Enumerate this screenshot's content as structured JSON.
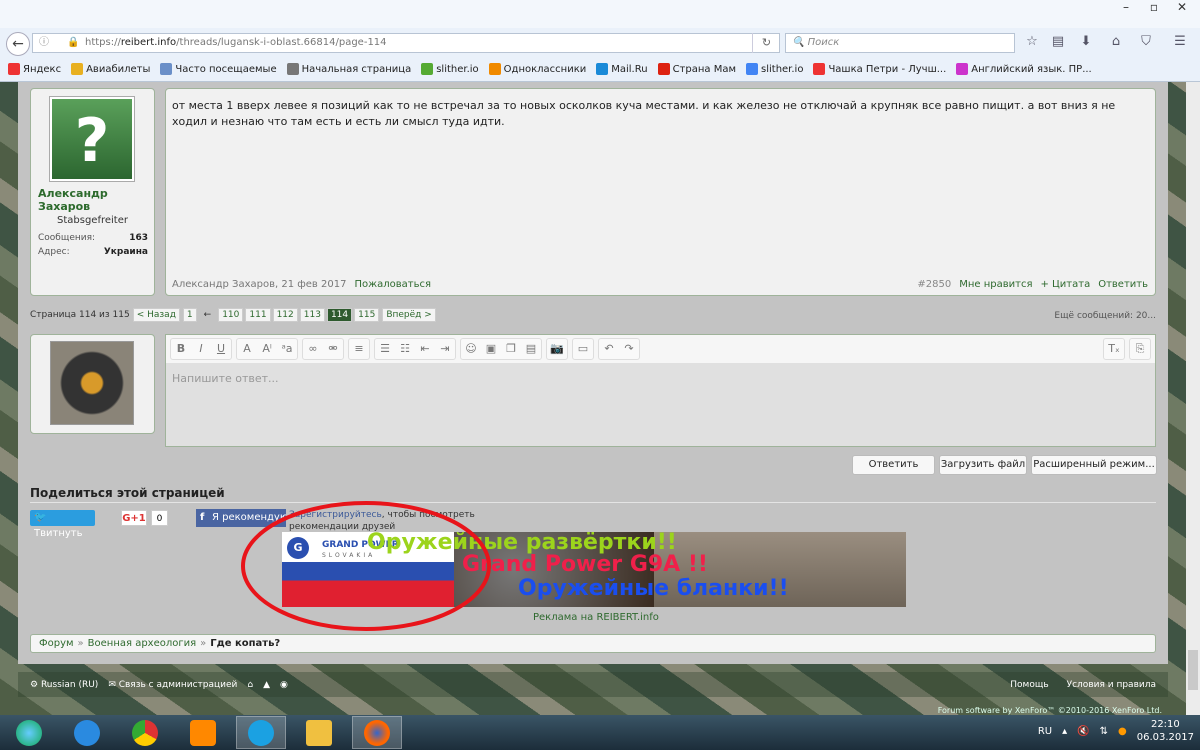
{
  "browser": {
    "url_domain": "reibert.info",
    "url_prefix": "https://",
    "url_path": "/threads/lugansk-i-oblast.66814/page-114",
    "search_placeholder": "Поиск",
    "bookmarks": [
      {
        "label": "Яндекс",
        "color": "#e33"
      },
      {
        "label": "Авиабилеты",
        "color": "#e8b020"
      },
      {
        "label": "Часто посещаемые",
        "color": "#6a8fc8"
      },
      {
        "label": "Начальная страница",
        "color": "#777"
      },
      {
        "label": "slither.io",
        "color": "#5a3"
      },
      {
        "label": "Одноклассники",
        "color": "#f08a00"
      },
      {
        "label": "Mail.Ru",
        "color": "#1a8ad8"
      },
      {
        "label": "Страна Мам",
        "color": "#d21"
      },
      {
        "label": "slither.io",
        "color": "#4285f4"
      },
      {
        "label": "Чашка Петри - Лучш...",
        "color": "#e33"
      },
      {
        "label": "Английский язык. ПР...",
        "color": "#c3c"
      }
    ]
  },
  "post": {
    "author": "Александр Захаров",
    "user_title": "Stabsgefreiter",
    "stats": [
      {
        "label": "Сообщения:",
        "value": "163"
      },
      {
        "label": "Адрес:",
        "value": "Украина"
      }
    ],
    "text": "от места 1 вверх левее я позиций как то не встречал за то новых осколков куча местами. и как железо не отключай а крупняк все равно пищит. а вот вниз я не ходил и незнаю что там есть и есть ли смысл туда идти.",
    "meta": "Александр Захаров, 21 фев 2017",
    "report": "Пожаловаться",
    "number": "#2850",
    "like": "Мне нравится",
    "quote": "+ Цитата",
    "reply": "Ответить"
  },
  "pagination": {
    "label": "Страница 114 из 115",
    "prev": "< Назад",
    "first": "1",
    "gap": "←",
    "pages": [
      "110",
      "111",
      "112",
      "113",
      "114",
      "115"
    ],
    "current": "114",
    "next": "Вперёд >",
    "more": "Ещё сообщений: 20..."
  },
  "editor": {
    "placeholder": "Напишите ответ...",
    "reply": "Ответить",
    "upload": "Загрузить файл",
    "advanced": "Расширенный режим..."
  },
  "share": {
    "heading": "Поделиться этой страницей",
    "tweet": "Твитнуть",
    "gplus": "G+1",
    "gplus_count": "0",
    "fb": "Я рекомендую",
    "fb_link": "Зарегистрируйтесь",
    "fb_text": ", чтобы посмотреть рекомендации друзей"
  },
  "ad": {
    "brand": "GRAND POWER",
    "country": "SLOVAKIA",
    "line1": "Оружейные развёртки!!",
    "line2": "Grand Power G9A !!",
    "line3": "Оружейные бланки!!",
    "label": "Реклама на REIBERT.info"
  },
  "breadcrumb": [
    "Форум",
    "Военная археология",
    "Где копать?"
  ],
  "footer": {
    "lang": "Russian (RU)",
    "contact": "Связь с администрацией",
    "help": "Помощь",
    "terms": "Условия и правила",
    "copyright": "Forum software by XenForo™ ©2010-2016 XenForo Ltd."
  },
  "taskbar": {
    "lang": "RU",
    "time": "22:10",
    "date": "06.03.2017"
  }
}
